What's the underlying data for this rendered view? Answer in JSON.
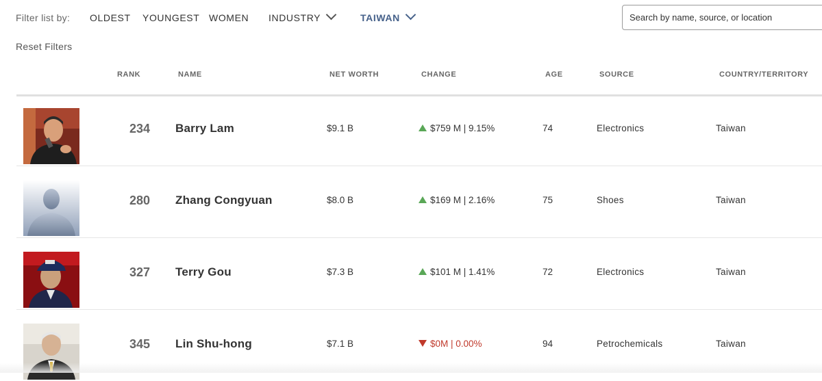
{
  "filters": {
    "label": "Filter list by:",
    "options": [
      "OLDEST",
      "YOUNGEST",
      "WOMEN"
    ],
    "industry": "INDUSTRY",
    "country": "TAIWAN",
    "active_color": "#46618a"
  },
  "search": {
    "placeholder": "Search by name, source, or location",
    "value": ""
  },
  "reset_label": "Reset Filters",
  "columns": [
    "RANK",
    "NAME",
    "NET WORTH",
    "CHANGE",
    "AGE",
    "SOURCE",
    "COUNTRY/TERRITORY"
  ],
  "rows": [
    {
      "rank": "234",
      "name": "Barry Lam",
      "net_worth": "$9.1 B",
      "change": "$759 M | 9.15%",
      "direction": "up",
      "age": "74",
      "source": "Electronics",
      "country": "Taiwan",
      "photo": "photo"
    },
    {
      "rank": "280",
      "name": "Zhang Congyuan",
      "net_worth": "$8.0 B",
      "change": "$169 M | 2.16%",
      "direction": "up",
      "age": "75",
      "source": "Shoes",
      "country": "Taiwan",
      "photo": "silhouette-placeholder"
    },
    {
      "rank": "327",
      "name": "Terry Gou",
      "net_worth": "$7.3 B",
      "change": "$101 M | 1.41%",
      "direction": "up",
      "age": "72",
      "source": "Electronics",
      "country": "Taiwan",
      "photo": "photo"
    },
    {
      "rank": "345",
      "name": "Lin Shu-hong",
      "net_worth": "$7.1 B",
      "change": "$0M | 0.00%",
      "direction": "down",
      "age": "94",
      "source": "Petrochemicals",
      "country": "Taiwan",
      "photo": "photo"
    }
  ],
  "colors": {
    "up": "#5aa757",
    "down": "#c0392b"
  }
}
